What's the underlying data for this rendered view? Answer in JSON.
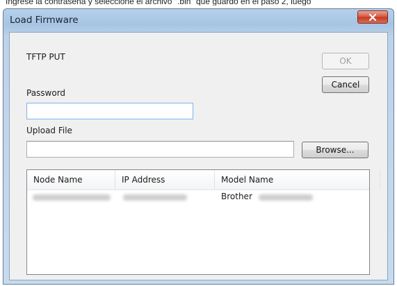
{
  "caption": "Ingrese la contraseña y seleccione el archivo \".bin\" que guardó en el paso 2, luego",
  "window": {
    "title": "Load Firmware",
    "close_icon": "close-icon"
  },
  "form": {
    "mode_label": "TFTP PUT",
    "password_label": "Password",
    "password_value": "",
    "upload_label": "Upload File",
    "upload_value": "",
    "ok_label": "OK",
    "cancel_label": "Cancel",
    "browse_label": "Browse..."
  },
  "device_list": {
    "columns": [
      "Node Name",
      "IP Address",
      "Model Name"
    ],
    "rows": [
      {
        "node_name_visible": "",
        "ip_visible": "",
        "model_prefix": "Brother"
      }
    ]
  },
  "colors": {
    "title_bar": "#a7c4e3",
    "close_button": "#c73a21",
    "client_bg": "#f0f0f0"
  }
}
